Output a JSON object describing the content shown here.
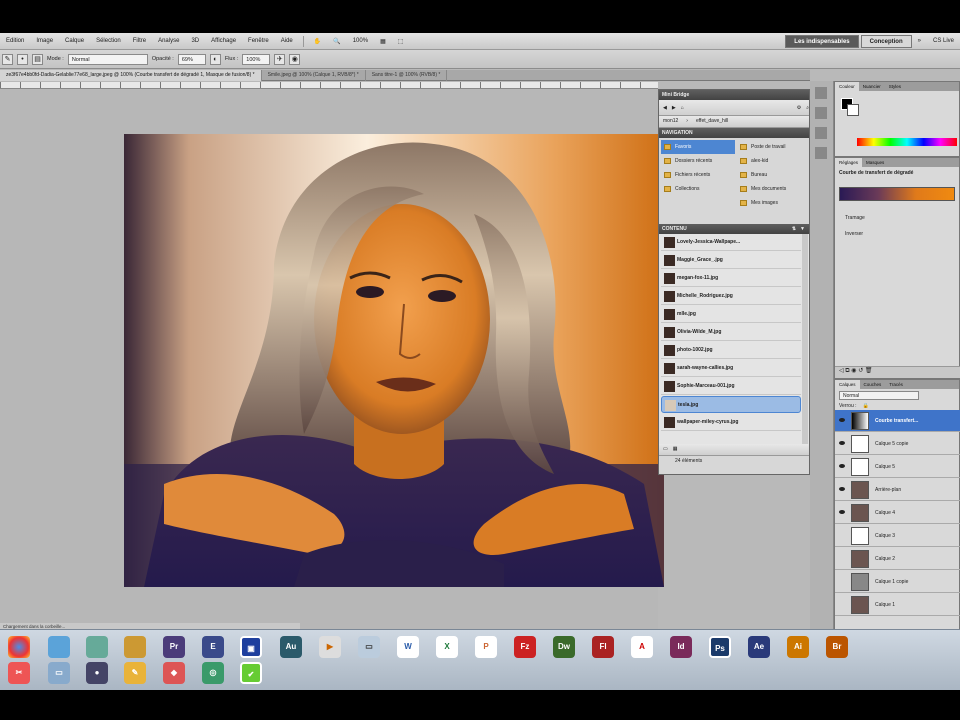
{
  "menubar": {
    "items": [
      "Edition",
      "Image",
      "Calque",
      "Sélection",
      "Filtre",
      "Analyse",
      "3D",
      "Affichage",
      "Fenêtre",
      "Aide"
    ],
    "zoom": "100%",
    "workspaces": {
      "active": "Les indispensables",
      "other": "Conception"
    },
    "cslive": "CS Live"
  },
  "options": {
    "mode_label": "Mode :",
    "mode_value": "Normal",
    "opacity_label": "Opacité :",
    "opacity_value": "69%",
    "flow_label": "Flux :",
    "flow_value": "100%"
  },
  "tabs": [
    "ze3f67e4bb0fd-Dadia-Gelablie77e68_large.jpeg @ 100% (Courbe transfert de dégradé 1, Masque de fusion/8) *",
    "Smile.jpeg @ 100% (Calque 1, RVB/8*) *",
    "Sans titre-1 @ 100% (RVB/8) *"
  ],
  "bridge": {
    "title": "Mini Bridge",
    "path": [
      "mon12",
      "effet_dave_hill"
    ],
    "nav_header": "NAVIGATION",
    "nav_left": [
      "Favoris",
      "Dossiers récents",
      "Fichiers récents",
      "Collections"
    ],
    "nav_right": [
      "Poste de travail",
      "alex-kid",
      "Bureau",
      "Mes documents",
      "Mes images"
    ],
    "content_header": "CONTENU",
    "files": [
      "Lovely-Jessica-Wallpape...",
      "Maggie_Grace_.jpg",
      "megan-fox-11.jpg",
      "Michelle_Rodriguez.jpg",
      "mlle.jpg",
      "Olivia-Wilde_M.jpg",
      "photo-1002.jpg",
      "sarah-wayne-callies.jpg",
      "Sophie-Marceau-001.jpg",
      "tesla.jpg",
      "wallpaper-miley-cyrus.jpg"
    ],
    "selected_index": 9,
    "count": "24 éléments"
  },
  "color": {
    "tabs": [
      "Couleur",
      "Nuancier",
      "Styles"
    ]
  },
  "adjust": {
    "tabs": [
      "Réglages",
      "Masques"
    ],
    "title": "Courbe de transfert de dégradé",
    "opt1": "Tramage",
    "opt2": "Inverser"
  },
  "layers": {
    "tabs": [
      "Calques",
      "Couches",
      "Tracés"
    ],
    "blend": "Normal",
    "opacity_label": "Opacité :",
    "lock_label": "Verrou :",
    "items": [
      "Courbe transfert...",
      "Calque 5 copie",
      "Calque 5",
      "Arrière-plan",
      "Calque 4",
      "Calque 3",
      "Calque 2",
      "Calque 1 copie",
      "Calque 1"
    ],
    "selected_index": 0
  },
  "status": "Chargement dans la corbeille..."
}
